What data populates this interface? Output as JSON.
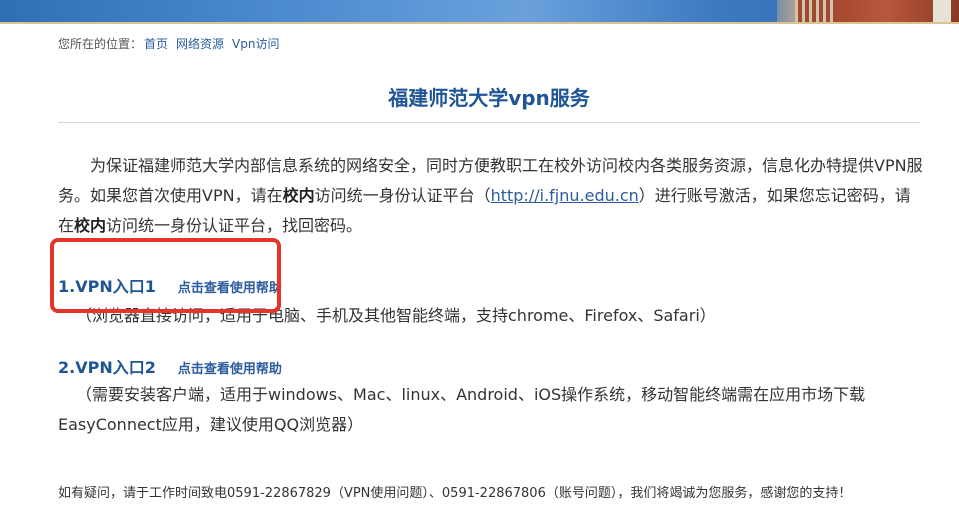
{
  "breadcrumb": {
    "prefix": "您所在的位置：",
    "items": [
      "首页",
      "网络资源",
      "Vpn访问"
    ]
  },
  "title": "福建师范大学vpn服务",
  "intro": {
    "part1": "为保证福建师范大学内部信息系统的网络安全，同时方便教职工在校外访问校内各类服务资源，信息化办特提供VPN服务。如果您首次使用VPN，请在",
    "bold1": "校内",
    "part2": "访问统一身份认证平台（",
    "link": "http://i.fjnu.edu.cn",
    "part3": "）进行账号激活，如果您忘记密码，请在",
    "bold2": "校内",
    "part4": "访问统一身份认证平台，找回密码。"
  },
  "entries": [
    {
      "num": "1.",
      "name": "VPN入口1",
      "help": "点击查看使用帮助",
      "desc": "（浏览器直接访问，适用于电脑、手机及其他智能终端，支持chrome、Firefox、Safari）"
    },
    {
      "num": "2.",
      "name": "VPN入口2",
      "help": "点击查看使用帮助",
      "desc": "（需要安装客户端，适用于windows、Mac、linux、Android、iOS操作系统，移动智能终端需在应用市场下载EasyConnect应用，建议使用QQ浏览器）"
    }
  ],
  "footer": "如有疑问，请于工作时间致电0591-22867829（VPN使用问题）、0591-22867806（账号问题），我们将竭诚为您服务，感谢您的支持！",
  "colors": {
    "title": "#1f5594",
    "link": "#2b5c9e",
    "highlight": "#e5352b"
  }
}
